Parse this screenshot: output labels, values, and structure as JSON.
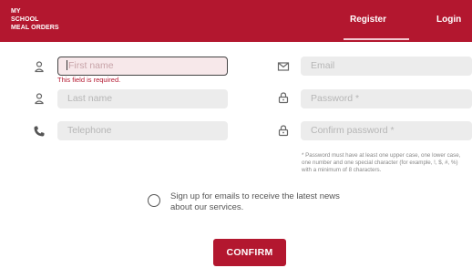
{
  "header": {
    "brand_lines": [
      "MY",
      "SCHOOL",
      "MEAL ORDERS"
    ],
    "nav": {
      "register": "Register",
      "login": "Login"
    },
    "bg_color": "#b3172f"
  },
  "form": {
    "first_name": {
      "placeholder": "First name",
      "error": "This field is required.",
      "icon": "user-icon"
    },
    "last_name": {
      "placeholder": "Last name",
      "icon": "user-icon"
    },
    "telephone": {
      "placeholder": "Telephone",
      "icon": "phone-icon"
    },
    "email": {
      "placeholder": "Email",
      "icon": "envelope-icon"
    },
    "password": {
      "placeholder": "Password *",
      "icon": "lock-icon"
    },
    "confirm_password": {
      "placeholder": "Confirm password *",
      "icon": "lock-icon"
    },
    "password_hint": "* Password must have at least one upper case, one lower case, one number and one special character (for example, !, $, #, %) with a minimum of 8 characters.",
    "signup_label": "Sign up for emails to receive the latest news about our services.",
    "confirm_label": "CONFIRM"
  }
}
